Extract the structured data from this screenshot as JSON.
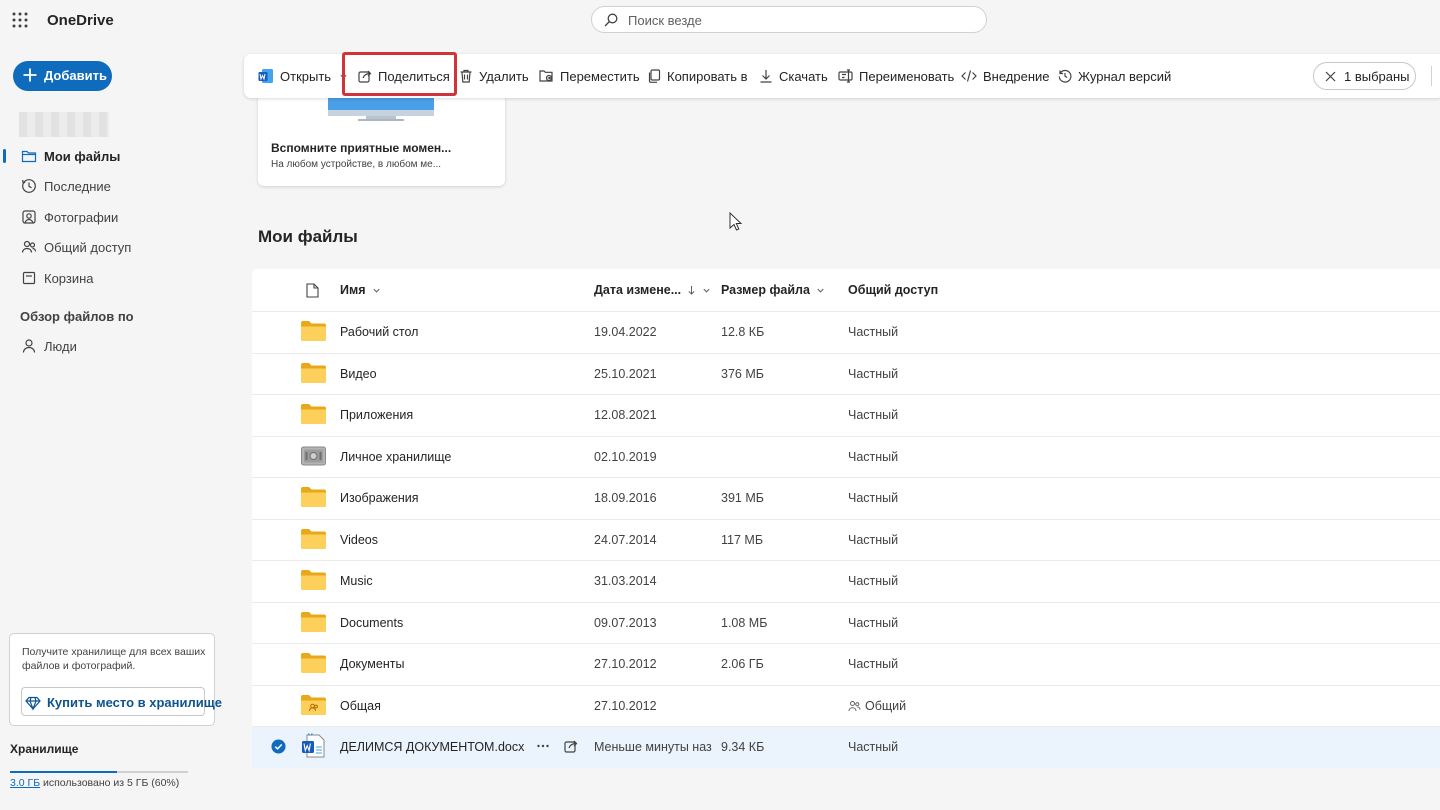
{
  "header": {
    "app_title": "OneDrive",
    "search_placeholder": "Поиск везде"
  },
  "sidebar": {
    "add_label": "Добавить",
    "nav": [
      {
        "label": "Мои файлы",
        "icon": "folder-icon",
        "active": true
      },
      {
        "label": "Последние",
        "icon": "clock-icon"
      },
      {
        "label": "Фотографии",
        "icon": "photo-icon"
      },
      {
        "label": "Общий доступ",
        "icon": "people-icon"
      },
      {
        "label": "Корзина",
        "icon": "trash-icon"
      }
    ],
    "browse_title": "Обзор файлов по",
    "browse_items": [
      {
        "label": "Люди",
        "icon": "person-icon"
      }
    ],
    "storage_promo": "Получите хранилище для всех ваших файлов и фотографий.",
    "buy_label": "Купить место в хранилище",
    "storage_title": "Хранилище",
    "storage_used": "3.0 ГБ",
    "storage_rest": " использовано из 5 ГБ (60%)",
    "storage_fraction": 0.6
  },
  "commands": {
    "open": "Открыть",
    "share": "Поделиться",
    "delete": "Удалить",
    "move": "Переместить",
    "copy": "Копировать в",
    "download": "Скачать",
    "rename": "Переименовать",
    "embed": "Внедрение",
    "history": "Журнал версий",
    "selected": "1 выбраны"
  },
  "promo": {
    "title": "Вспомните приятные момен...",
    "subtitle": "На любом устройстве, в любом ме..."
  },
  "main": {
    "section_title": "Мои файлы",
    "columns": {
      "name": "Имя",
      "modified": "Дата измене...",
      "size": "Размер файла",
      "sharing": "Общий доступ"
    },
    "files": [
      {
        "name": "Рабочий стол",
        "modified": "19.04.2022",
        "size": "12.8 КБ",
        "sharing": "Частный",
        "type": "folder"
      },
      {
        "name": "Видео",
        "modified": "25.10.2021",
        "size": "376 МБ",
        "sharing": "Частный",
        "type": "folder"
      },
      {
        "name": "Приложения",
        "modified": "12.08.2021",
        "size": "",
        "sharing": "Частный",
        "type": "folder"
      },
      {
        "name": "Личное хранилище",
        "modified": "02.10.2019",
        "size": "",
        "sharing": "Частный",
        "type": "vault"
      },
      {
        "name": "Изображения",
        "modified": "18.09.2016",
        "size": "391 МБ",
        "sharing": "Частный",
        "type": "folder"
      },
      {
        "name": "Videos",
        "modified": "24.07.2014",
        "size": "117 МБ",
        "sharing": "Частный",
        "type": "folder"
      },
      {
        "name": "Music",
        "modified": "31.03.2014",
        "size": "",
        "sharing": "Частный",
        "type": "folder"
      },
      {
        "name": "Documents",
        "modified": "09.07.2013",
        "size": "1.08 МБ",
        "sharing": "Частный",
        "type": "folder"
      },
      {
        "name": "Документы",
        "modified": "27.10.2012",
        "size": "2.06 ГБ",
        "sharing": "Частный",
        "type": "folder"
      },
      {
        "name": "Общая",
        "modified": "27.10.2012",
        "size": "",
        "sharing": "Общий",
        "type": "shared-folder"
      },
      {
        "name": "ДЕЛИМСЯ ДОКУМЕНТОМ.docx",
        "modified": "Меньше минуты наз",
        "size": "9.34 КБ",
        "sharing": "Частный",
        "type": "docx",
        "selected": true
      }
    ]
  },
  "colors": {
    "accent": "#0f6cbd",
    "highlight": "#d13438",
    "folder": "#f8c53a",
    "selected_row": "#ebf3fc"
  }
}
